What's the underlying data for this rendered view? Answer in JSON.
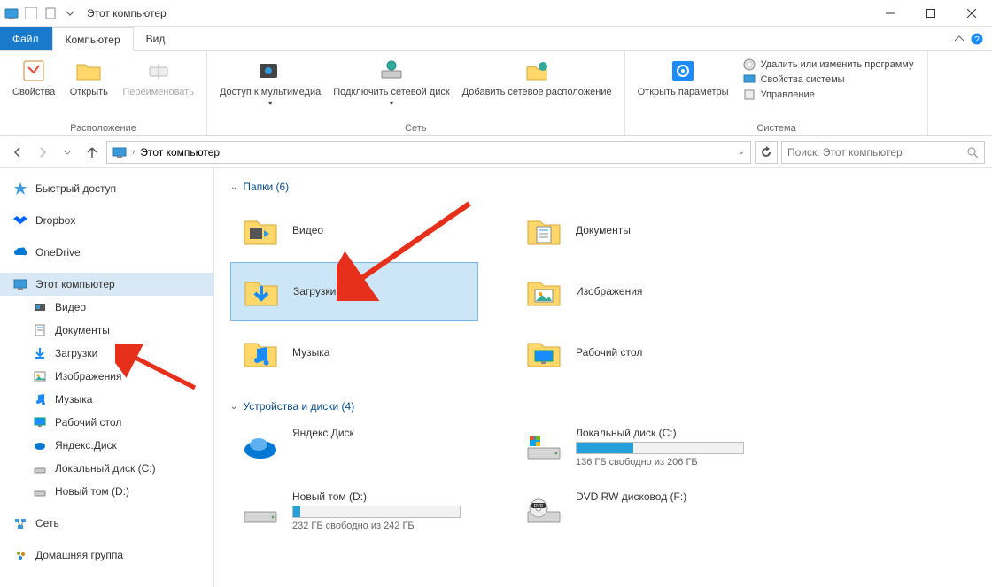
{
  "window": {
    "title": "Этот компьютер"
  },
  "tabs": {
    "file": "Файл",
    "computer": "Компьютер",
    "view": "Вид"
  },
  "ribbon": {
    "location": {
      "label": "Расположение",
      "properties": "Свойства",
      "open": "Открыть",
      "rename": "Переименовать"
    },
    "network": {
      "label": "Сеть",
      "media": "Доступ к мультимедиа",
      "map_drive": "Подключить сетевой диск",
      "add_location": "Добавить сетевое расположение"
    },
    "system": {
      "label": "Система",
      "open_settings": "Открыть параметры",
      "link1": "Удалить или изменить программу",
      "link2": "Свойства системы",
      "link3": "Управление"
    }
  },
  "address": {
    "path": "Этот компьютер",
    "search_placeholder": "Поиск: Этот компьютер"
  },
  "sidebar": {
    "quick": "Быстрый доступ",
    "dropbox": "Dropbox",
    "onedrive": "OneDrive",
    "thispc": "Этот компьютер",
    "items": [
      "Видео",
      "Документы",
      "Загрузки",
      "Изображения",
      "Музыка",
      "Рабочий стол",
      "Яндекс.Диск",
      "Локальный диск (C:)",
      "Новый том (D:)"
    ],
    "network": "Сеть",
    "homegroup": "Домашняя группа"
  },
  "folders": {
    "header": "Папки (6)",
    "items": [
      {
        "name": "Видео",
        "icon": "video"
      },
      {
        "name": "Документы",
        "icon": "docs"
      },
      {
        "name": "Загрузки",
        "icon": "downloads",
        "selected": true
      },
      {
        "name": "Изображения",
        "icon": "pictures"
      },
      {
        "name": "Музыка",
        "icon": "music"
      },
      {
        "name": "Рабочий стол",
        "icon": "desktop"
      }
    ]
  },
  "devices": {
    "header": "Устройства и диски (4)",
    "items": [
      {
        "name": "Яндекс.Диск",
        "icon": "yadisk"
      },
      {
        "name": "Локальный диск (C:)",
        "icon": "drive-win",
        "free": "136 ГБ свободно из 206 ГБ",
        "fill": 0.34
      },
      {
        "name": "Новый том (D:)",
        "icon": "drive",
        "free": "232 ГБ свободно из 242 ГБ",
        "fill": 0.04
      },
      {
        "name": "DVD RW дисковод (F:)",
        "icon": "dvd"
      }
    ]
  }
}
